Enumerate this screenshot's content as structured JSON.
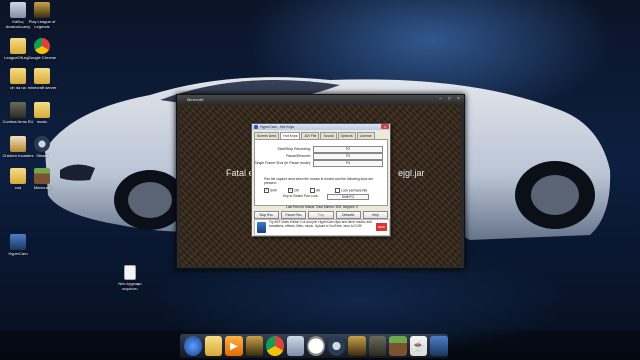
{
  "desktop": {
    "icons": [
      {
        "label": "Κάδος Ανακύκλωσης",
        "icon": "recycle-bin-icon"
      },
      {
        "label": "Play League of Legends",
        "icon": "league-icon"
      },
      {
        "label": "LeagueOfLeg...",
        "icon": "folder-icon"
      },
      {
        "label": "Google Chrome",
        "icon": "chrome-icon"
      },
      {
        "label": "oh na na",
        "icon": "folder-icon"
      },
      {
        "label": "minecraft server",
        "icon": "folder-icon"
      },
      {
        "label": "Combat Arms EU",
        "icon": "combat-arms-icon"
      },
      {
        "label": "music",
        "icon": "folder-icon"
      },
      {
        "label": "Chicken Invaders",
        "icon": "chicken-invaders-icon"
      },
      {
        "label": "Steam",
        "icon": "steam-icon"
      },
      {
        "label": "cod",
        "icon": "folder-icon"
      },
      {
        "label": "Minecraft",
        "icon": "minecraft-icon"
      },
      {
        "label": "HyperCam",
        "icon": "hypercam-icon"
      },
      {
        "label": "Νέο έγγραφο κειμένου",
        "icon": "text-file-icon"
      }
    ]
  },
  "game_window": {
    "title": "Minecraft",
    "message_left": "Fatal e",
    "message_right": "ejgl.jar"
  },
  "dialog": {
    "title": "HyperCam - Hot Keys",
    "tabs": [
      "Screen Area",
      "Hot Keys",
      "AVI File",
      "Sound",
      "Options",
      "License"
    ],
    "active_tab": "Hot Keys",
    "hotkeys": [
      {
        "label": "Start/Stop Recording:",
        "value": "F2"
      },
      {
        "label": "Pause/Resume:",
        "value": "F3"
      },
      {
        "label": "Single Frame Shot (in Pause mode):",
        "value": "F4"
      }
    ],
    "pan_text": "Pan the capture area when the mouse is moved and the following keys are pressed:",
    "checks": [
      {
        "label": "Shift",
        "checked": true
      },
      {
        "label": "Ctrl",
        "checked": true
      },
      {
        "label": "Alt",
        "checked": false
      },
      {
        "label": "Lock permanently",
        "checked": false
      }
    ],
    "switch_label": "Key to Switch Pan Lock:",
    "switch_value": "Shift+F2",
    "status": "Last Record Status: Total frames: 505, skipped: 0",
    "buttons": [
      "Stop Rec.",
      "Pause Rec.",
      "Play",
      "Defaults",
      "Help"
    ],
    "promo_text": "Try AVS Video Editor! Cut and join HyperCam clips and other media, add transitions, effects, titles, music. Upload to YouTube, burn to DVD!",
    "promo_badge": "NEW"
  },
  "taskbar": {
    "items": [
      "start-orb-icon",
      "explorer-icon",
      "media-player-icon",
      "league-icon",
      "chrome-icon",
      "recycle-icon",
      "clock-icon",
      "steam-icon",
      "league-icon",
      "cod-icon",
      "minecraft-icon",
      "java-icon",
      "hypercam-icon"
    ]
  },
  "colors": {
    "accent": "#3a7bd5",
    "dialog_bg": "#ece9d8"
  }
}
